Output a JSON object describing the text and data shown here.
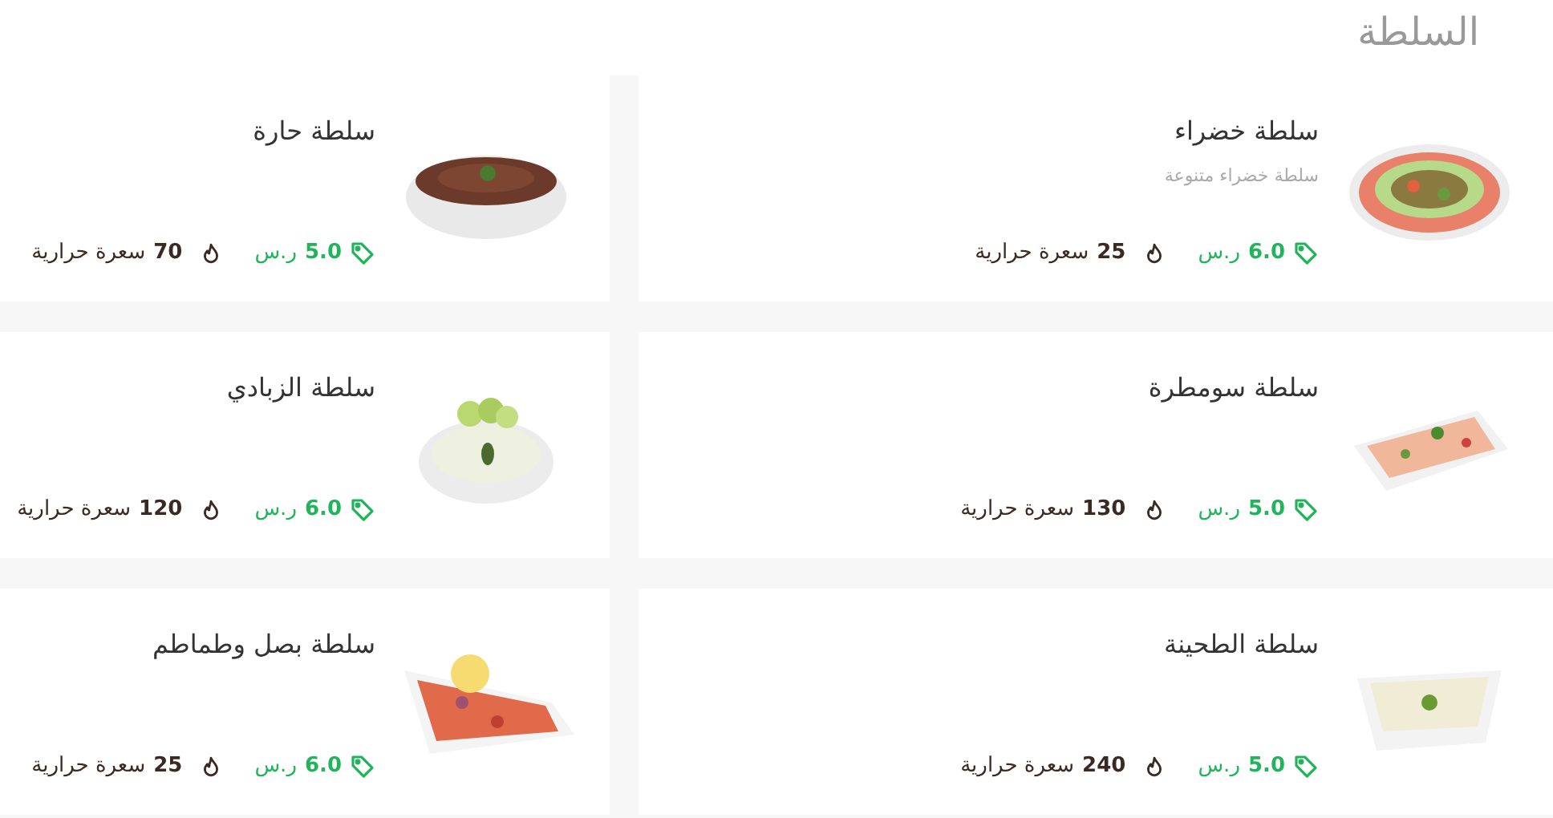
{
  "section_title": "السلطة",
  "items": [
    {
      "name": "سلطة خضراء",
      "description": "سلطة خضراء متنوعة",
      "price": "6.0",
      "currency": "ر.س",
      "calories": "25",
      "calories_unit": "سعرة حرارية"
    },
    {
      "name": "سلطة حارة",
      "price": "5.0",
      "currency": "ر.س",
      "calories": "70",
      "calories_unit": "سعرة حرارية"
    },
    {
      "name": "سلطة سومطرة",
      "price": "5.0",
      "currency": "ر.س",
      "calories": "130",
      "calories_unit": "سعرة حرارية"
    },
    {
      "name": "سلطة الزبادي",
      "price": "6.0",
      "currency": "ر.س",
      "calories": "120",
      "calories_unit": "سعرة حرارية"
    },
    {
      "name": "سلطة الطحينة",
      "price": "5.0",
      "currency": "ر.س",
      "calories": "240",
      "calories_unit": "سعرة حرارية"
    },
    {
      "name": "سلطة بصل وطماطم",
      "price": "6.0",
      "currency": "ر.س",
      "calories": "25",
      "calories_unit": "سعرة حرارية"
    }
  ]
}
